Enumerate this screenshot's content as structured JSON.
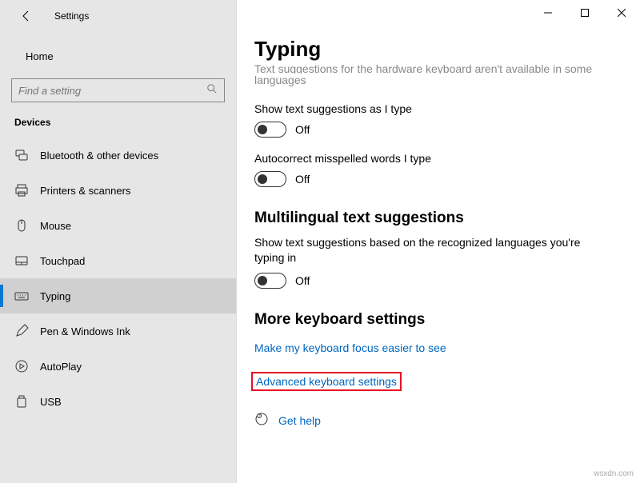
{
  "app": {
    "title": "Settings"
  },
  "sidebar": {
    "home_label": "Home",
    "search_placeholder": "Find a setting",
    "section_header": "Devices",
    "items": [
      {
        "label": "Bluetooth & other devices"
      },
      {
        "label": "Printers & scanners"
      },
      {
        "label": "Mouse"
      },
      {
        "label": "Touchpad"
      },
      {
        "label": "Typing"
      },
      {
        "label": "Pen & Windows Ink"
      },
      {
        "label": "AutoPlay"
      },
      {
        "label": "USB"
      }
    ]
  },
  "page": {
    "title": "Typing",
    "truncated_line1": "Text suggestions for the hardware keyboard aren't available in some",
    "truncated_line2": "languages",
    "settings": [
      {
        "label": "Show text suggestions as I type",
        "state": "Off"
      },
      {
        "label": "Autocorrect misspelled words I type",
        "state": "Off"
      }
    ],
    "multilingual": {
      "heading": "Multilingual text suggestions",
      "desc": "Show text suggestions based on the recognized languages you're typing in",
      "state": "Off"
    },
    "more": {
      "heading": "More keyboard settings",
      "link1": "Make my keyboard focus easier to see",
      "link2": "Advanced keyboard settings"
    },
    "help_label": "Get help"
  },
  "watermark": "wsxdn.com"
}
